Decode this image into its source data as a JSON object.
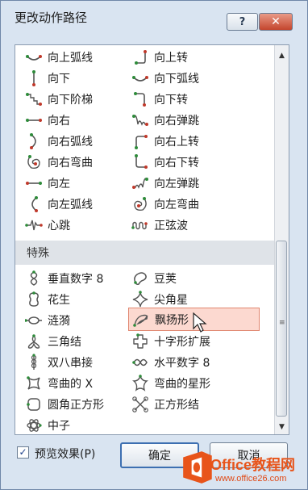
{
  "window": {
    "title": "更改动作路径",
    "help_label": "?",
    "close_label": "✕"
  },
  "list": {
    "rows": [
      {
        "left": {
          "label": "向上弧线",
          "icon": "arc-up-icon"
        },
        "right": {
          "label": "向上转",
          "icon": "turn-up-icon"
        }
      },
      {
        "left": {
          "label": "向下",
          "icon": "down-icon"
        },
        "right": {
          "label": "向下弧线",
          "icon": "arc-down-icon"
        }
      },
      {
        "left": {
          "label": "向下阶梯",
          "icon": "stairs-down-icon"
        },
        "right": {
          "label": "向下转",
          "icon": "turn-down-icon"
        }
      },
      {
        "left": {
          "label": "向右",
          "icon": "right-icon"
        },
        "right": {
          "label": "向右弹跳",
          "icon": "bounce-right-icon"
        }
      },
      {
        "left": {
          "label": "向右弧线",
          "icon": "arc-right-icon"
        },
        "right": {
          "label": "向右上转",
          "icon": "turn-up-right-icon"
        }
      },
      {
        "left": {
          "label": "向右弯曲",
          "icon": "curvy-right-icon"
        },
        "right": {
          "label": "向右下转",
          "icon": "turn-down-right-icon"
        }
      },
      {
        "left": {
          "label": "向左",
          "icon": "left-icon"
        },
        "right": {
          "label": "向左弹跳",
          "icon": "bounce-left-icon"
        }
      },
      {
        "left": {
          "label": "向左弧线",
          "icon": "arc-left-icon"
        },
        "right": {
          "label": "向左弯曲",
          "icon": "curvy-left-icon"
        }
      },
      {
        "left": {
          "label": "心跳",
          "icon": "heartbeat-icon"
        },
        "right": {
          "label": "正弦波",
          "icon": "sine-wave-icon"
        }
      }
    ],
    "category": "特殊",
    "special_rows": [
      {
        "left": {
          "label": "垂直数字 8",
          "icon": "figure-8-vertical-icon"
        },
        "right": {
          "label": "豆荚",
          "icon": "bean-icon"
        }
      },
      {
        "left": {
          "label": "花生",
          "icon": "peanut-icon"
        },
        "right": {
          "label": "尖角星",
          "icon": "pointy-star-icon"
        }
      },
      {
        "left": {
          "label": "涟漪",
          "icon": "ripple-icon"
        },
        "right": {
          "label": "飘扬形",
          "icon": "swoosh-icon",
          "selected": true
        }
      },
      {
        "left": {
          "label": "三角结",
          "icon": "trefoil-knot-icon"
        },
        "right": {
          "label": "十字形扩展",
          "icon": "plus-expand-icon"
        }
      },
      {
        "left": {
          "label": "双八串接",
          "icon": "double-eight-icon"
        },
        "right": {
          "label": "水平数字 8",
          "icon": "figure-8-horizontal-icon"
        }
      },
      {
        "left": {
          "label": "弯曲的 X",
          "icon": "curvy-x-icon"
        },
        "right": {
          "label": "弯曲的星形",
          "icon": "curvy-star-icon"
        }
      },
      {
        "left": {
          "label": "圆角正方形",
          "icon": "rounded-square-icon"
        },
        "right": {
          "label": "正方形结",
          "icon": "square-knot-icon"
        }
      },
      {
        "left": {
          "label": "中子",
          "icon": "neutron-icon"
        }
      }
    ]
  },
  "footer": {
    "preview_label": "预览效果(P)",
    "preview_checked": true,
    "ok_label": "确定",
    "cancel_label": "取消"
  },
  "watermark": {
    "brand": "Office教程网",
    "url": "www.office26.com"
  },
  "colors": {
    "dialog_bg": "#d9e4f1",
    "selection_bg": "#fcd9d0",
    "icon_green": "#2e8b3a",
    "icon_red": "#c0392b"
  }
}
